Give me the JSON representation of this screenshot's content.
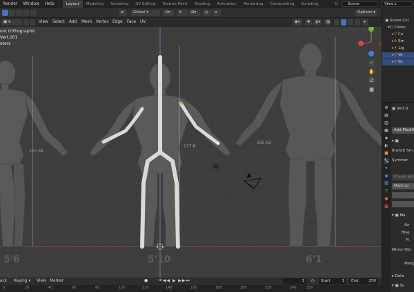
{
  "topbar": {
    "menu": [
      "Render",
      "Window",
      "Help"
    ],
    "tabs": [
      "Layout",
      "Modeling",
      "Sculpting",
      "UV Editing",
      "Texture Paint",
      "Shading",
      "Animation",
      "Rendering",
      "Compositing",
      "Scripting"
    ],
    "active_tab": "Layout",
    "scene": "Scene",
    "view_layer": "View L"
  },
  "header": {
    "orientation": "Global",
    "options": "Options",
    "menus": [
      "View",
      "Select",
      "Add",
      "Mesh",
      "Vertex",
      "Edge",
      "Face",
      "UV"
    ]
  },
  "viewport": {
    "info_line1": "ont Orthographic",
    "info_line2": "Vert.001",
    "info_line3": "eters",
    "height_labels": [
      "5'6",
      "5'10",
      "6'1"
    ],
    "dim_labels": [
      "167.64",
      "177.8",
      "185.42"
    ]
  },
  "outliner": {
    "rows": [
      "Scene Col",
      "Collec",
      "Cu",
      "Em",
      "Lig",
      "Ve",
      "Ve"
    ],
    "selected_rows": [
      5,
      6
    ]
  },
  "properties": {
    "object_name": "Vert.0",
    "add_modifier": "Add Modifi",
    "rows": [
      "Branch Sm",
      "Symmet",
      "Create Arm",
      "Mark Lo",
      "Ma",
      "Ax",
      "Bise",
      "Fl",
      "Mirror Obj",
      "Merg",
      "Data",
      "Su"
    ]
  },
  "timeline": {
    "playback": "ack",
    "keying": "Keying",
    "view": "View",
    "marker": "Marker",
    "current_frame": "1",
    "start_label": "Start",
    "start": "1",
    "end_label": "End",
    "end": "250",
    "ticks": [
      "0",
      "20",
      "40",
      "60",
      "80",
      "100",
      "120",
      "140",
      "160",
      "180",
      "200",
      "220",
      "240",
      "250"
    ]
  }
}
